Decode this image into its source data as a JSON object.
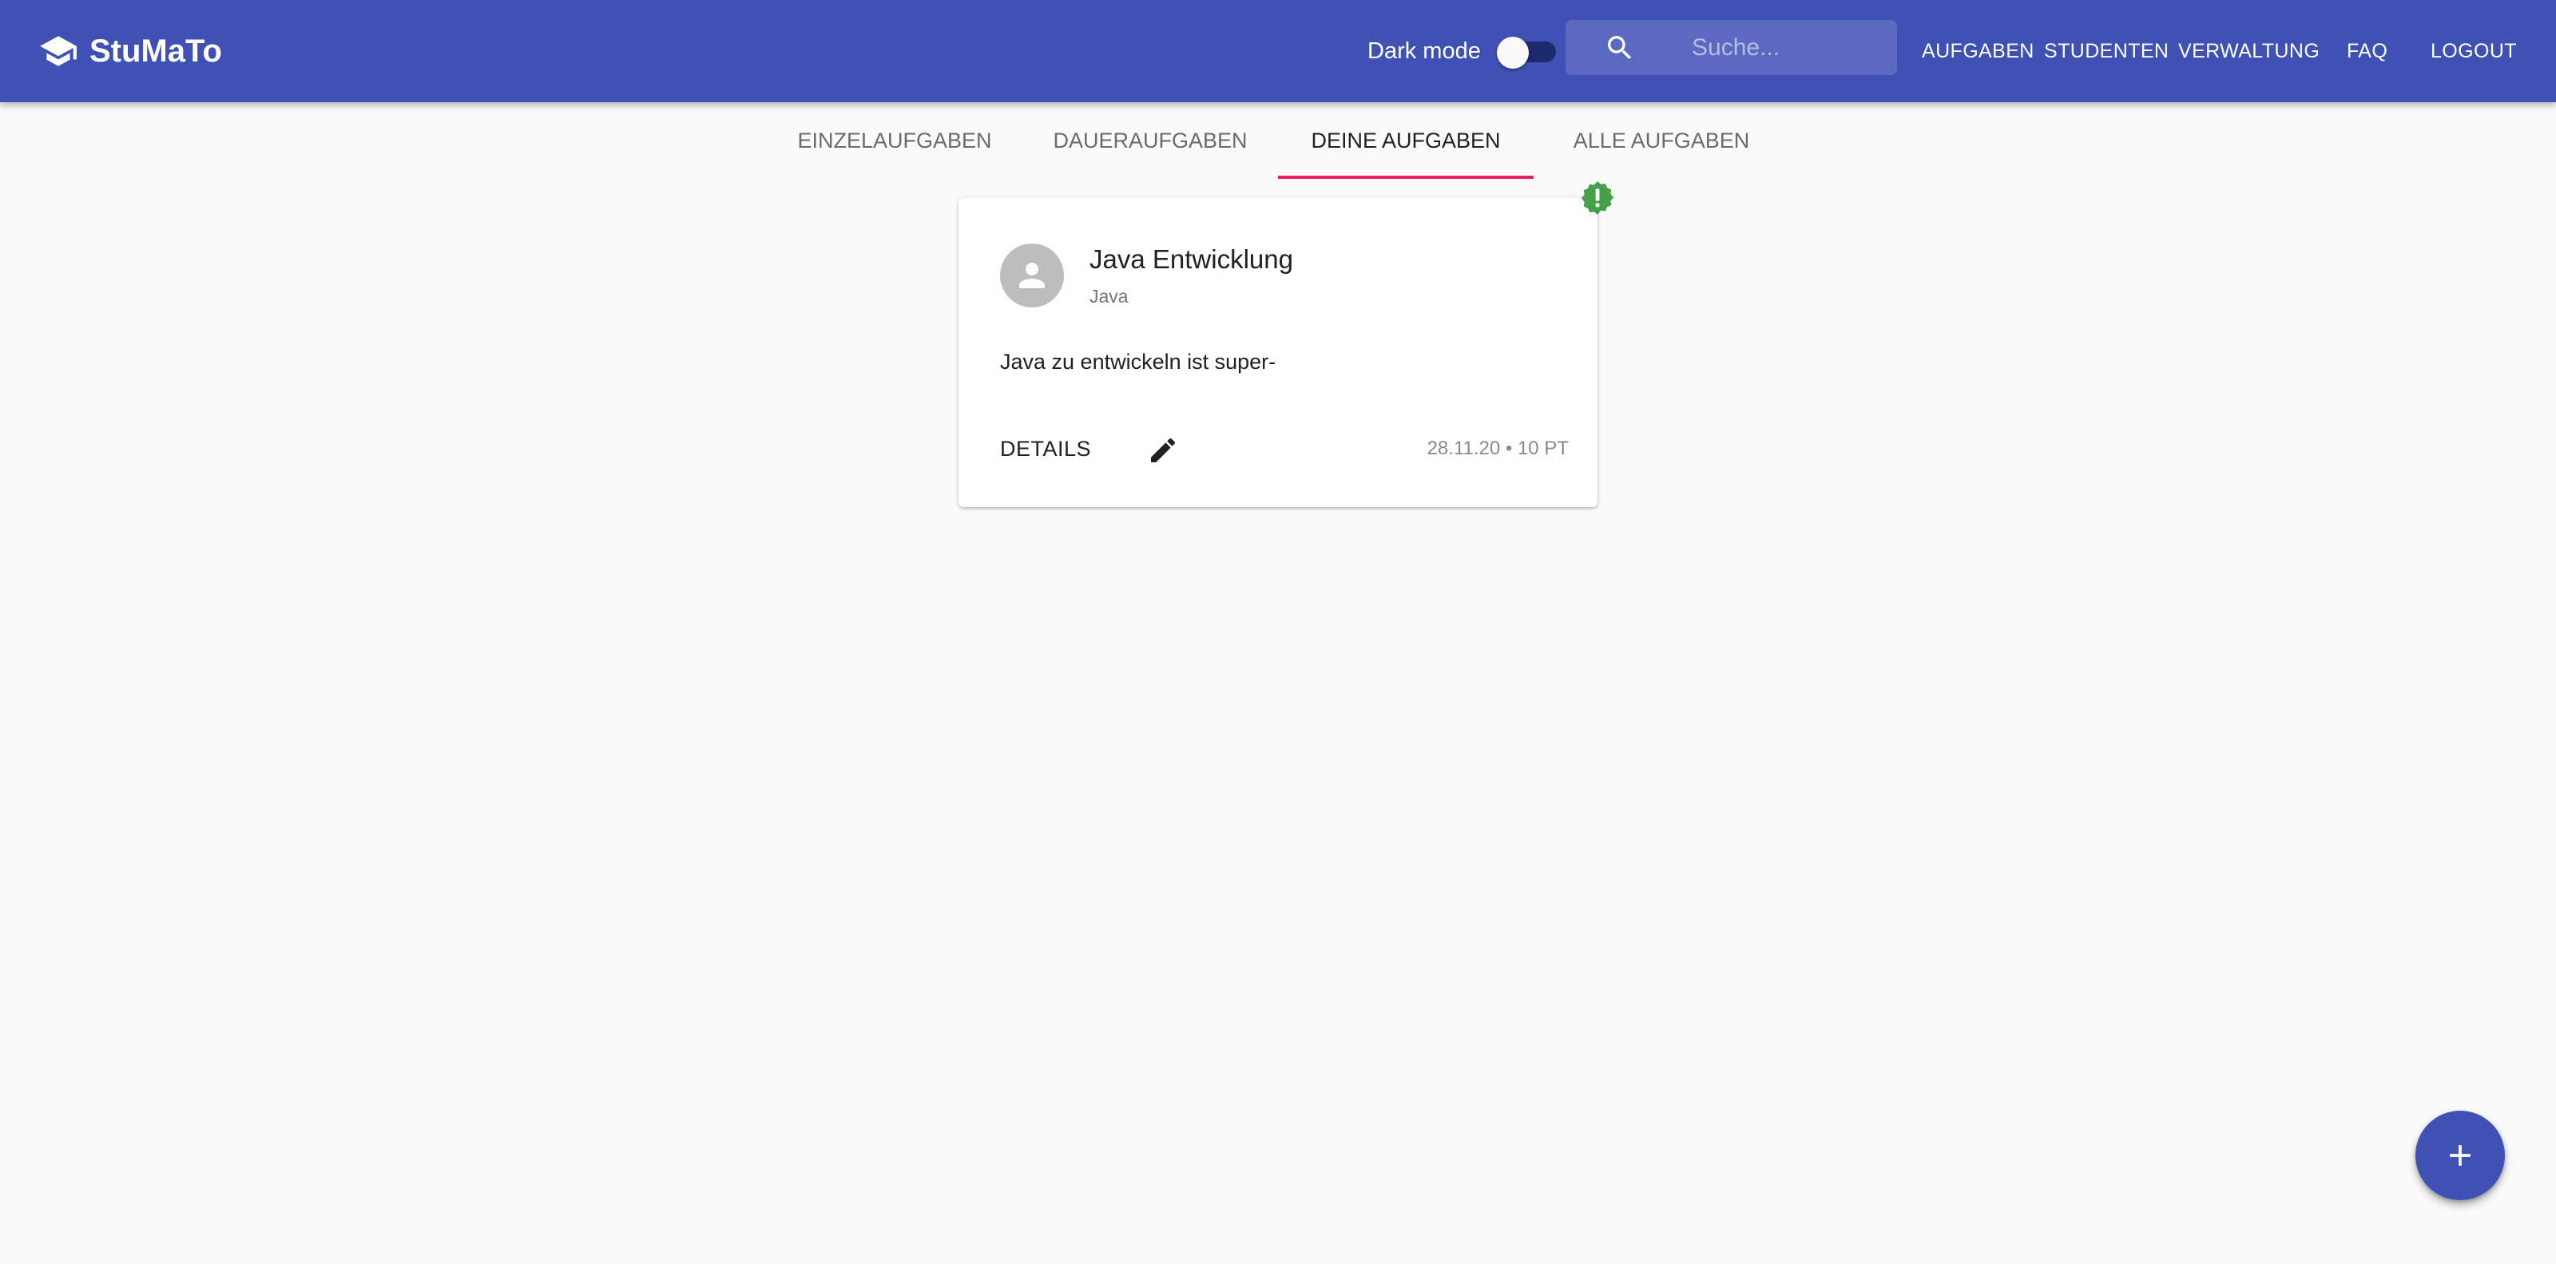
{
  "app": {
    "title": "StuMaTo",
    "logo_icon": "school-cap-icon",
    "brand_color": "#3f51b5"
  },
  "header": {
    "dark_mode_label": "Dark mode",
    "dark_mode_enabled": false,
    "search": {
      "placeholder": "Suche...",
      "value": "",
      "icon": "search-icon"
    },
    "nav": [
      {
        "label": "AUFGABEN"
      },
      {
        "label": "STUDENTEN"
      },
      {
        "label": "VERWALTUNG"
      },
      {
        "label": "FAQ"
      },
      {
        "label": "LOGOUT"
      }
    ]
  },
  "tabs": {
    "items": [
      {
        "label": "EINZELAUFGABEN"
      },
      {
        "label": "DAUERAUFGABEN"
      },
      {
        "label": "DEINE AUFGABEN"
      },
      {
        "label": "ALLE AUFGABEN"
      }
    ],
    "active_index": 2,
    "indicator_color": "#e91e63"
  },
  "tasks": [
    {
      "avatar_icon": "person-icon",
      "title": "Java Entwicklung",
      "subtitle": "Java",
      "description": "Java zu entwickeln ist super-",
      "details_label": "DETAILS",
      "edit_icon": "pencil-icon",
      "meta": "28.11.20 • 10 PT",
      "badge": {
        "icon": "alert-badge-icon",
        "color": "#43a047"
      }
    }
  ],
  "fab": {
    "icon": "plus-icon"
  }
}
